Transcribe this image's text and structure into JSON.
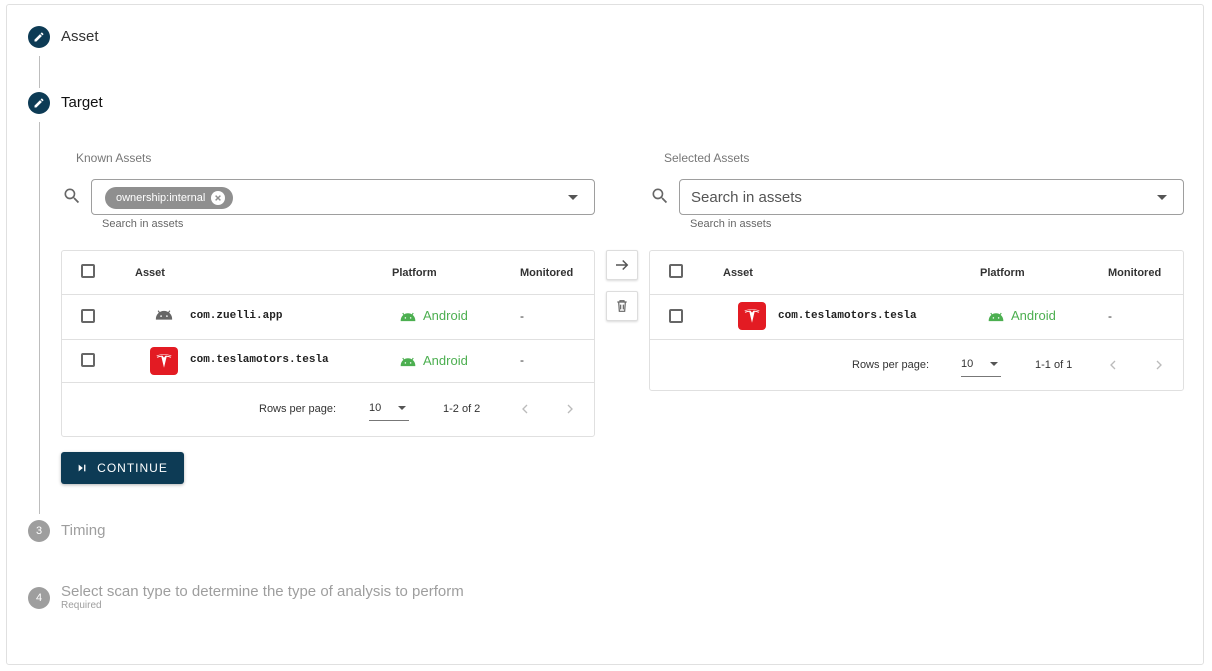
{
  "stepper": {
    "steps": [
      {
        "label": "Asset",
        "number": ""
      },
      {
        "label": "Target",
        "number": ""
      },
      {
        "label": "Timing",
        "number": "3"
      },
      {
        "label": "Select scan type to determine the type of analysis to perform",
        "number": "4",
        "sub": "Required"
      }
    ]
  },
  "known_assets": {
    "title": "Known Assets",
    "chip": "ownership:internal",
    "helper": "Search in assets",
    "columns": {
      "asset": "Asset",
      "platform": "Platform",
      "monitored": "Monitored"
    },
    "rows": [
      {
        "asset": "com.zuelli.app",
        "platform": "Android",
        "monitored": "-",
        "icon": "android-icon"
      },
      {
        "asset": "com.teslamotors.tesla",
        "platform": "Android",
        "monitored": "-",
        "icon": "tesla-logo"
      }
    ],
    "pager": {
      "rows_label": "Rows per page:",
      "rows_value": "10",
      "range": "1-2 of 2"
    }
  },
  "selected_assets": {
    "title": "Selected Assets",
    "placeholder": "Search in assets",
    "helper": "Search in assets",
    "columns": {
      "asset": "Asset",
      "platform": "Platform",
      "monitored": "Monitored"
    },
    "rows": [
      {
        "asset": "com.teslamotors.tesla",
        "platform": "Android",
        "monitored": "-",
        "icon": "tesla-logo"
      }
    ],
    "pager": {
      "rows_label": "Rows per page:",
      "rows_value": "10",
      "range": "1-1 of 1"
    }
  },
  "continue_button": {
    "label": "CONTINUE"
  },
  "colors": {
    "primary": "#0d3b55",
    "android_green": "#4caf50",
    "tesla_red": "#e31b23"
  }
}
